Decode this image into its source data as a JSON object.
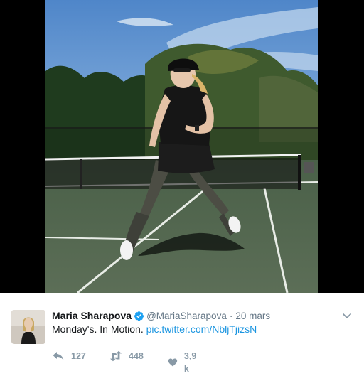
{
  "media": {
    "photo_description_icon": "tennis-court-photo"
  },
  "tweet": {
    "author_name": "Maria Sharapova",
    "verified_icon": "verified-badge-icon",
    "handle": "@MariaSharapova",
    "separator": "·",
    "timestamp": "20 mars",
    "text": "Monday's. In Motion.",
    "link": "pic.twitter.com/NbljTjizsN",
    "actions": {
      "reply_count": "127",
      "retweet_count": "448",
      "like_count": "3,9 k"
    }
  },
  "colors": {
    "link": "#1b95e0",
    "verified": "#1da1f2",
    "muted": "#657786",
    "action": "#8899a6"
  }
}
